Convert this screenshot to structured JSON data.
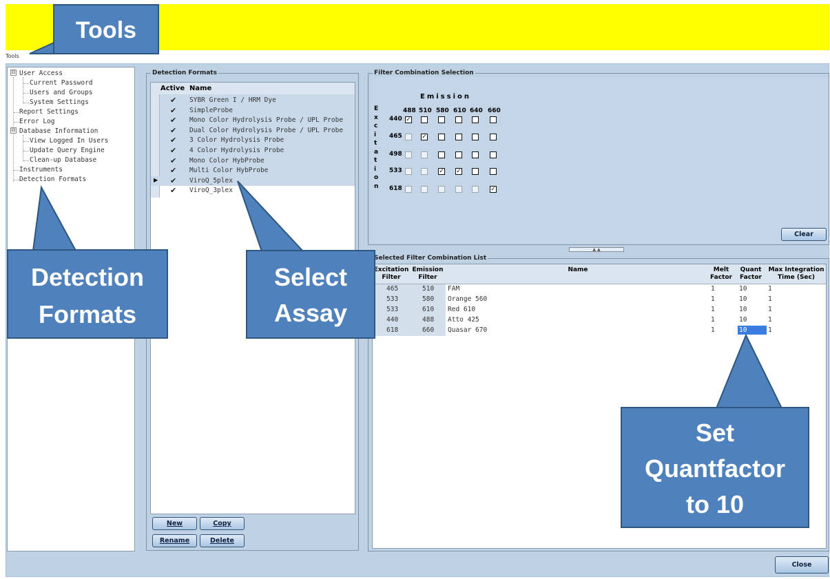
{
  "top_bar": {
    "tools_label": "Tools"
  },
  "window": {
    "tools_word": "Tools"
  },
  "tree": {
    "items": [
      {
        "label": "User Access",
        "expander": "⊟"
      },
      {
        "label": "Current Password"
      },
      {
        "label": "Users and Groups"
      },
      {
        "label": "System Settings"
      },
      {
        "label": "Report Settings"
      },
      {
        "label": "Error Log"
      },
      {
        "label": "Database Information",
        "expander": "⊟"
      },
      {
        "label": "View Logged In Users"
      },
      {
        "label": "Update Query Engine"
      },
      {
        "label": "Clean-up Database"
      },
      {
        "label": "Instruments"
      },
      {
        "label": "Detection Formats"
      }
    ]
  },
  "detection_formats": {
    "title": "Detection Formats",
    "col_active": "Active",
    "col_name": "Name",
    "checkmark": "✔",
    "pointer": "▶",
    "rows": [
      {
        "name": "SYBR Green I / HRM Dye"
      },
      {
        "name": "SimpleProbe"
      },
      {
        "name": "Mono Color Hydrolysis Probe / UPL Probe"
      },
      {
        "name": "Dual Color Hydrolysis Probe / UPL Probe"
      },
      {
        "name": "3 Color Hydrolysis Probe"
      },
      {
        "name": "4 Color Hydrolysis Probe"
      },
      {
        "name": "Mono Color HybProbe"
      },
      {
        "name": "Multi Color HybProbe"
      },
      {
        "name": "ViroQ_5plex"
      },
      {
        "name": "ViroQ_3plex"
      }
    ],
    "buttons": {
      "new": "New",
      "copy": "Copy",
      "rename": "Rename",
      "delete": "Delete"
    }
  },
  "filter_selection": {
    "title": "Filter Combination Selection",
    "emission_label": "Emission",
    "excitation_letters": [
      "E",
      "x",
      "c",
      "i",
      "t",
      "a",
      "t",
      "i",
      "o",
      "n"
    ],
    "emission_filters": [
      "488",
      "510",
      "580",
      "610",
      "640",
      "660"
    ],
    "excitation_filters": [
      "440",
      "465",
      "498",
      "533",
      "618"
    ],
    "grid": [
      [
        "checked",
        "black",
        "black",
        "black",
        "black",
        "black"
      ],
      [
        "dim",
        "checked",
        "black",
        "black",
        "black",
        "black"
      ],
      [
        "dim",
        "dim",
        "black",
        "black",
        "black",
        "black"
      ],
      [
        "dim",
        "dim",
        "checked",
        "checked",
        "black",
        "black"
      ],
      [
        "dim",
        "dim",
        "dim",
        "dim",
        "dim",
        "checked"
      ]
    ],
    "check_glyph": "✓",
    "clear_button": "Clear"
  },
  "selected_list": {
    "title": "Selected Filter Combination List",
    "headers": {
      "excitation": [
        "Excitation",
        "Filter"
      ],
      "emission": [
        "Emission",
        "Filter"
      ],
      "name": "Name",
      "melt": [
        "Melt",
        "Factor"
      ],
      "quant": [
        "Quant",
        "Factor"
      ],
      "max_integration": [
        "Max Integration",
        "Time (Sec)"
      ]
    },
    "rows": [
      {
        "excitation": "465",
        "emission": "510",
        "name": "FAM",
        "melt": "1",
        "quant": "10",
        "max": "1"
      },
      {
        "excitation": "533",
        "emission": "580",
        "name": "Orange 560",
        "melt": "1",
        "quant": "10",
        "max": "1"
      },
      {
        "excitation": "533",
        "emission": "610",
        "name": "Red 610",
        "melt": "1",
        "quant": "10",
        "max": "1"
      },
      {
        "excitation": "440",
        "emission": "488",
        "name": "Atto 425",
        "melt": "1",
        "quant": "10",
        "max": "1"
      },
      {
        "excitation": "618",
        "emission": "660",
        "name": "Quasar 670",
        "melt": "1",
        "quant": "10",
        "max": "1"
      }
    ]
  },
  "close_button": "Close",
  "callouts": {
    "detection_formats": [
      "Detection",
      "Formats"
    ],
    "select_assay": [
      "Select",
      "Assay"
    ],
    "set_quantfactor": [
      "Set",
      "Quantfactor",
      "to 10"
    ]
  },
  "colors": {
    "banner": "#ffff00",
    "callout_fill": "#4f81bd",
    "window_bg": "#bfd2e4",
    "selected_cell": "#3a7de0"
  }
}
